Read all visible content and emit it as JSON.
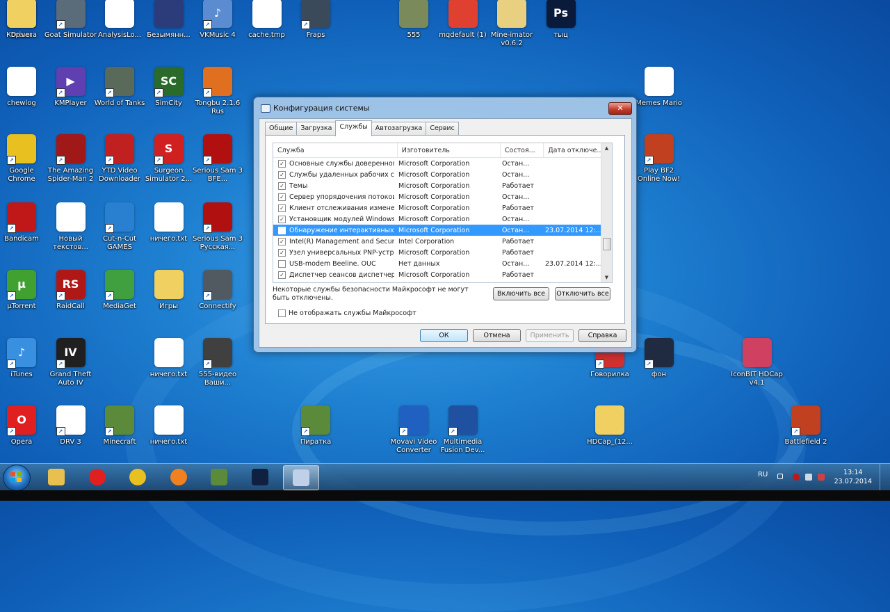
{
  "desktop": {
    "icons": [
      {
        "label": "Корзина",
        "color": "#c8d8e8",
        "glyph": "🗑",
        "shortcut": false
      },
      {
        "label": "Goat Simulator",
        "color": "#5a6b7a",
        "glyph": "",
        "shortcut": true
      },
      {
        "label": "AnalysisLo...",
        "color": "#ffffff",
        "glyph": "",
        "shortcut": false
      },
      {
        "label": "Безымянн...",
        "color": "#2c3c7a",
        "glyph": "",
        "shortcut": false
      },
      {
        "label": "VKMusic 4",
        "color": "#5b8bd0",
        "glyph": "♪",
        "shortcut": true
      },
      {
        "label": "cache.tmp",
        "color": "#ffffff",
        "glyph": "",
        "shortcut": false
      },
      {
        "label": "Fraps",
        "color": "#3a4a5a",
        "glyph": "",
        "shortcut": true
      },
      {
        "label": "555",
        "color": "#7a8a5a",
        "glyph": "",
        "shortcut": false
      },
      {
        "label": "mqdefault (1)",
        "color": "#e04030",
        "glyph": "",
        "shortcut": false
      },
      {
        "label": "Mine-imator v0.6.2",
        "color": "#e8d080",
        "glyph": "",
        "shortcut": false
      },
      {
        "label": "тыц",
        "color": "#0a1a3a",
        "glyph": "Ps",
        "shortcut": false
      },
      {
        "label": "chewlog",
        "color": "#ffffff",
        "glyph": "",
        "shortcut": false
      },
      {
        "label": "KMPlayer",
        "color": "#6040b0",
        "glyph": "▶",
        "shortcut": true
      },
      {
        "label": "World of Tanks",
        "color": "#5a6a5a",
        "glyph": "",
        "shortcut": true
      },
      {
        "label": "SimCity",
        "color": "#2a6a2a",
        "glyph": "SC",
        "shortcut": true
      },
      {
        "label": "Tongbu 2.1.6 Rus",
        "color": "#e07020",
        "glyph": "",
        "shortcut": true
      },
      {
        "label": "Memes Mario",
        "color": "#ffffff",
        "glyph": "",
        "shortcut": false
      },
      {
        "label": "Google Chrome",
        "color": "#e8c020",
        "glyph": "",
        "shortcut": true
      },
      {
        "label": "The Amazing Spider-Man 2",
        "color": "#a01818",
        "glyph": "",
        "shortcut": true
      },
      {
        "label": "YTD Video Downloader",
        "color": "#c02020",
        "glyph": "",
        "shortcut": true
      },
      {
        "label": "Surgeon Simulator 2...",
        "color": "#d02020",
        "glyph": "S",
        "shortcut": true
      },
      {
        "label": "Serious Sam 3 BFE...",
        "color": "#b01010",
        "glyph": "",
        "shortcut": true
      },
      {
        "label": "Play BF2 Online Now!",
        "color": "#c04020",
        "glyph": "",
        "shortcut": true
      },
      {
        "label": "Bandicam",
        "color": "#c01818",
        "glyph": "",
        "shortcut": true
      },
      {
        "label": "Новый текстов...",
        "color": "#ffffff",
        "glyph": "",
        "shortcut": false
      },
      {
        "label": "Cut-n-Cut GAMES",
        "color": "#2a80d0",
        "glyph": "",
        "shortcut": true
      },
      {
        "label": "ничего.txt",
        "color": "#ffffff",
        "glyph": "",
        "shortcut": false
      },
      {
        "label": "Serious Sam 3 Русская...",
        "color": "#b01010",
        "glyph": "",
        "shortcut": true
      },
      {
        "label": "µTorrent",
        "color": "#40a030",
        "glyph": "µ",
        "shortcut": true
      },
      {
        "label": "RaidCall",
        "color": "#b01818",
        "glyph": "RS",
        "shortcut": true
      },
      {
        "label": "MediaGet",
        "color": "#40a040",
        "glyph": "",
        "shortcut": true
      },
      {
        "label": "Игры",
        "color": "#f0d060",
        "glyph": "",
        "shortcut": false
      },
      {
        "label": "Connectify",
        "color": "#505a60",
        "glyph": "",
        "shortcut": true
      },
      {
        "label": "iTunes",
        "color": "#3a90e0",
        "glyph": "♪",
        "shortcut": true
      },
      {
        "label": "Grand Theft Auto IV",
        "color": "#202020",
        "glyph": "IV",
        "shortcut": true
      },
      {
        "label": "ничего.txt",
        "color": "#ffffff",
        "glyph": "",
        "shortcut": false
      },
      {
        "label": "555-видео Ваши...",
        "color": "#404040",
        "glyph": "",
        "shortcut": true
      },
      {
        "label": "Opera",
        "color": "#e02020",
        "glyph": "O",
        "shortcut": true
      },
      {
        "label": "DRV 3",
        "color": "#ffffff",
        "glyph": "",
        "shortcut": true
      },
      {
        "label": "Minecraft",
        "color": "#5a8a3a",
        "glyph": "",
        "shortcut": true
      },
      {
        "label": "ничего.txt",
        "color": "#ffffff",
        "glyph": "",
        "shortcut": false
      },
      {
        "label": "Пиратка",
        "color": "#5a8a3a",
        "glyph": "",
        "shortcut": true
      },
      {
        "label": "Movavi Video Converter",
        "color": "#2060c0",
        "glyph": "",
        "shortcut": true
      },
      {
        "label": "Multimedia Fusion Dev...",
        "color": "#2050a0",
        "glyph": "",
        "shortcut": true
      },
      {
        "label": "Говорилка",
        "color": "#d03030",
        "glyph": "",
        "shortcut": true
      },
      {
        "label": "фон",
        "color": "#202a40",
        "glyph": "",
        "shortcut": true
      },
      {
        "label": "IconBIT HDCap v4.1",
        "color": "#d04060",
        "glyph": "",
        "shortcut": false
      },
      {
        "label": "HDCap_(12...",
        "color": "#f0d060",
        "glyph": "",
        "shortcut": false
      },
      {
        "label": "Battlefield 2",
        "color": "#c04020",
        "glyph": "",
        "shortcut": true
      },
      {
        "label": "Driver",
        "color": "#f0d060",
        "glyph": "",
        "shortcut": false
      }
    ]
  },
  "dialog": {
    "title": "Конфигурация системы",
    "close_label": "✕",
    "tabs": [
      "Общие",
      "Загрузка",
      "Службы",
      "Автозагрузка",
      "Сервис"
    ],
    "active_tab": "Службы",
    "columns": [
      "Служба",
      "Изготовитель",
      "Состоя...",
      "Дата отключе..."
    ],
    "rows": [
      {
        "checked": true,
        "service": "Основные службы доверенного...",
        "vendor": "Microsoft Corporation",
        "status": "Остан...",
        "date": "",
        "selected": false
      },
      {
        "checked": true,
        "service": "Службы удаленных рабочих с...",
        "vendor": "Microsoft Corporation",
        "status": "Остан...",
        "date": "",
        "selected": false
      },
      {
        "checked": true,
        "service": "Темы",
        "vendor": "Microsoft Corporation",
        "status": "Работает",
        "date": "",
        "selected": false
      },
      {
        "checked": true,
        "service": "Сервер упорядочения потоков",
        "vendor": "Microsoft Corporation",
        "status": "Остан...",
        "date": "",
        "selected": false
      },
      {
        "checked": true,
        "service": "Клиент отслеживания измене...",
        "vendor": "Microsoft Corporation",
        "status": "Работает",
        "date": "",
        "selected": false
      },
      {
        "checked": true,
        "service": "Установщик модулей Windows",
        "vendor": "Microsoft Corporation",
        "status": "Остан...",
        "date": "",
        "selected": false
      },
      {
        "checked": false,
        "service": "Обнаружение интерактивных ...",
        "vendor": "Microsoft Corporation",
        "status": "Остан...",
        "date": "23.07.2014 12:...",
        "selected": true
      },
      {
        "checked": true,
        "service": "Intel(R) Management and Securi...",
        "vendor": "Intel Corporation",
        "status": "Работает",
        "date": "",
        "selected": false
      },
      {
        "checked": true,
        "service": "Узел универсальных PNP-устр...",
        "vendor": "Microsoft Corporation",
        "status": "Работает",
        "date": "",
        "selected": false
      },
      {
        "checked": false,
        "service": "USB-modem Beeline. OUC",
        "vendor": "Нет данных",
        "status": "Остан...",
        "date": "23.07.2014 12:...",
        "selected": false
      },
      {
        "checked": true,
        "service": "Диспетчер сеансов диспетчер...",
        "vendor": "Microsoft Corporation",
        "status": "Работает",
        "date": "",
        "selected": false
      }
    ],
    "note": "Некоторые службы безопасности Майкрософт не могут быть отключены.",
    "enable_all": "Включить все",
    "disable_all": "Отключить все",
    "hide_ms_label": "Не отображать службы Майкрософт",
    "hide_ms_checked": false,
    "ok": "ОК",
    "cancel": "Отмена",
    "apply": "Применить",
    "help": "Справка"
  },
  "taskbar": {
    "apps": [
      {
        "name": "explorer",
        "color": "#e8c050"
      },
      {
        "name": "opera",
        "color": "#e02020"
      },
      {
        "name": "chrome",
        "color": "#e8c020"
      },
      {
        "name": "media-player",
        "color": "#f08020"
      },
      {
        "name": "minecraft",
        "color": "#5a8a3a"
      },
      {
        "name": "vegas",
        "color": "#102040"
      },
      {
        "name": "msconfig",
        "color": "#c0d0e8"
      }
    ],
    "lang": "RU",
    "time": "13:14",
    "date": "23.07.2014"
  }
}
